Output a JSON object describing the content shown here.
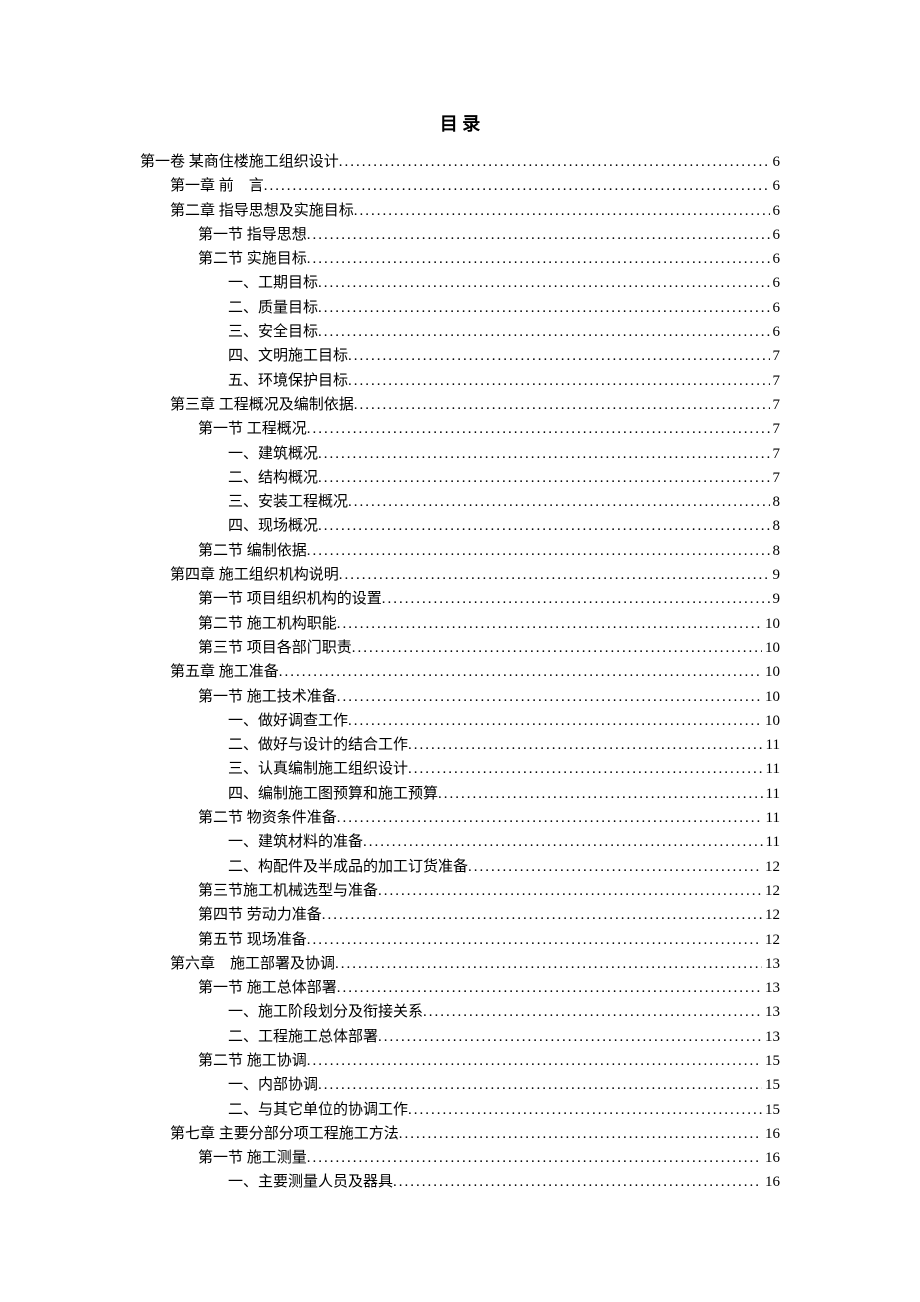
{
  "title": "目 录",
  "entries": [
    {
      "level": 0,
      "label": "第一卷 某商住楼施工组织设计",
      "page": "6"
    },
    {
      "level": 1,
      "label": "第一章 前　言",
      "page": "6"
    },
    {
      "level": 1,
      "label": "第二章 指导思想及实施目标",
      "page": "6"
    },
    {
      "level": 2,
      "label": "第一节 指导思想",
      "page": "6"
    },
    {
      "level": 2,
      "label": "第二节 实施目标",
      "page": "6"
    },
    {
      "level": 3,
      "label": "一、工期目标",
      "page": "6"
    },
    {
      "level": 3,
      "label": "二、质量目标",
      "page": "6"
    },
    {
      "level": 3,
      "label": "三、安全目标",
      "page": "6"
    },
    {
      "level": 3,
      "label": "四、文明施工目标",
      "page": "7"
    },
    {
      "level": 3,
      "label": "五、环境保护目标",
      "page": "7"
    },
    {
      "level": 1,
      "label": "第三章 工程概况及编制依据",
      "page": "7"
    },
    {
      "level": 2,
      "label": "第一节 工程概况",
      "page": "7"
    },
    {
      "level": 3,
      "label": "一、建筑概况",
      "page": "7"
    },
    {
      "level": 3,
      "label": "二、结构概况",
      "page": "7"
    },
    {
      "level": 3,
      "label": "三、安装工程概况",
      "page": "8"
    },
    {
      "level": 3,
      "label": "四、现场概况",
      "page": "8"
    },
    {
      "level": 2,
      "label": "第二节 编制依据",
      "page": "8"
    },
    {
      "level": 1,
      "label": "第四章 施工组织机构说明",
      "page": "9"
    },
    {
      "level": 2,
      "label": "第一节 项目组织机构的设置",
      "page": "9"
    },
    {
      "level": 2,
      "label": "第二节 施工机构职能",
      "page": "10"
    },
    {
      "level": 2,
      "label": "第三节 项目各部门职责",
      "page": "10"
    },
    {
      "level": 1,
      "label": "第五章 施工准备",
      "page": "10"
    },
    {
      "level": 2,
      "label": "第一节 施工技术准备",
      "page": "10"
    },
    {
      "level": 3,
      "label": "一、做好调查工作",
      "page": "10"
    },
    {
      "level": 3,
      "label": "二、做好与设计的结合工作",
      "page": "11"
    },
    {
      "level": 3,
      "label": "三、认真编制施工组织设计",
      "page": "11"
    },
    {
      "level": 3,
      "label": "四、编制施工图预算和施工预算",
      "page": "11"
    },
    {
      "level": 2,
      "label": "第二节 物资条件准备",
      "page": "11"
    },
    {
      "level": 3,
      "label": "一、建筑材料的准备",
      "page": "11"
    },
    {
      "level": 3,
      "label": "二、构配件及半成品的加工订货准备",
      "page": "12"
    },
    {
      "level": 2,
      "label": "第三节施工机械选型与准备",
      "page": "12"
    },
    {
      "level": 2,
      "label": "第四节 劳动力准备",
      "page": "12"
    },
    {
      "level": 2,
      "label": "第五节 现场准备",
      "page": "12"
    },
    {
      "level": 1,
      "label": "第六章　施工部署及协调",
      "page": "13"
    },
    {
      "level": 2,
      "label": "第一节 施工总体部署",
      "page": "13"
    },
    {
      "level": 3,
      "label": "一、施工阶段划分及衔接关系",
      "page": "13"
    },
    {
      "level": 3,
      "label": "二、工程施工总体部署",
      "page": "13"
    },
    {
      "level": 2,
      "label": "第二节 施工协调",
      "page": "15"
    },
    {
      "level": 3,
      "label": "一、内部协调",
      "page": "15"
    },
    {
      "level": 3,
      "label": "二、与其它单位的协调工作",
      "page": "15"
    },
    {
      "level": 1,
      "label": "第七章 主要分部分项工程施工方法",
      "page": "16"
    },
    {
      "level": 2,
      "label": "第一节 施工测量",
      "page": "16"
    },
    {
      "level": 3,
      "label": "一、主要测量人员及器具",
      "page": "16"
    }
  ]
}
